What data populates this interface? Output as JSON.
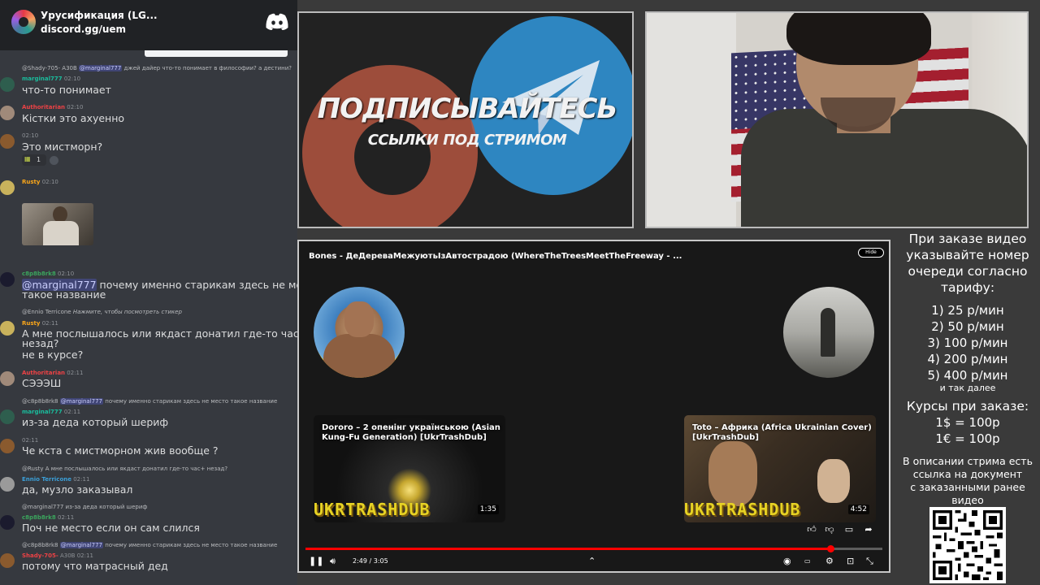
{
  "discord": {
    "server_name": "Урусификация (LG...",
    "invite": "discord.gg/uem",
    "messages": [
      {
        "reply_user": "@Shady-705-",
        "reply_badge": "А30В",
        "reply_mention": "@marginal777",
        "reply_text": "джей дайер что-то понимает в философии? а дестини?",
        "user": "marginal777",
        "time": "02:10",
        "text": "что-то понимает"
      },
      {
        "user": "Authoritarian",
        "time": "02:10",
        "text": "Кістки это ахуенно"
      },
      {
        "user": "",
        "time": "02:10",
        "text": "Это мистморн?",
        "reaction_count": "1"
      },
      {
        "user": "Rusty",
        "time": "02:10",
        "attachment": "gif"
      },
      {
        "user": "c8p8b8rk8",
        "time": "02:10",
        "mention": "@marginal777",
        "text": " почему именно старикам здесь не место",
        "text2": "такое название"
      },
      {
        "reply_user": "@Ennio Terricone",
        "reply_text": "Нажмите, чтобы посмотреть стикер",
        "user": "Rusty",
        "time": "02:11",
        "text": "А мне послышалось или якдаст донатил где-то час+",
        "text2": "незад?",
        "text3": "не в курсе?"
      },
      {
        "user": "Authoritarian",
        "time": "02:11",
        "text": "СЭЭЭШ"
      },
      {
        "reply_user": "@c8p8b8rk8",
        "reply_mention": "@marginal777",
        "reply_text": "почему именно старикам здесь не место такое название",
        "user": "marginal777",
        "time": "02:11",
        "text": "из-за деда который шериф"
      },
      {
        "user": "",
        "time": "02:11",
        "text": "Че кста с мистморном жив вообще ?"
      },
      {
        "reply_user": "@Rusty",
        "reply_text": "А мне послышалось или якдаст донатил где-то час+ незад?",
        "user": "Ennio Terricone",
        "time": "02:11",
        "text": "да, музло заказывал"
      },
      {
        "reply_user": "@marginal777",
        "reply_text": "из-за деда который шериф",
        "user": "c8p8b8rk8",
        "time": "02:11",
        "text": "Поч не место если он сам слился"
      },
      {
        "reply_user": "@c8p8b8rk8",
        "reply_mention": "@marginal777",
        "reply_text": "почему именно старикам здесь не место такое название",
        "user": "Shady-705-",
        "badge": "А30В",
        "time": "02:11",
        "text": "потому что матрасный дед"
      }
    ]
  },
  "promo": {
    "title": "ПОДПИСЫВАЙТЕСЬ",
    "subtitle": "ССЫЛКИ ПОД СТРИМОМ"
  },
  "player": {
    "title": "Bones - ДеДереваМежуютьIзАвтострадою (WhereTheTreesMeetTheFreeway - ...",
    "hide_label": "Hide",
    "time": "2:49 / 3:05",
    "progress": 0.91,
    "cards": [
      {
        "title": "Dororo – 2 опенінг українською (Asian Kung-Fu Generation) [UkrTrashDub]",
        "brand": "UKRTRASHDUB",
        "duration": "1:35"
      },
      {
        "title": "Toto – Африка (Africa Ukrainian Cover) [UkrTrashDub]",
        "brand": "UKRTRASHDUB",
        "duration": "4:52"
      }
    ]
  },
  "info": {
    "head_lines": [
      "При заказе видео",
      "указывайте номер",
      "очереди согласно",
      "тарифу:"
    ],
    "prices": [
      "1) 25 р/мин",
      "2) 50 р/мин",
      "3) 100 р/мин",
      "4) 200 р/мин",
      "5) 400 р/мин"
    ],
    "more": "и так далее",
    "currency_title": "Курсы при заказе:",
    "currency_lines": [
      "1$ = 100р",
      "1€ = 100р"
    ],
    "desc_lines": [
      "В описании стрима есть",
      "ссылка на документ",
      "с заказанными ранее",
      "видео"
    ]
  }
}
